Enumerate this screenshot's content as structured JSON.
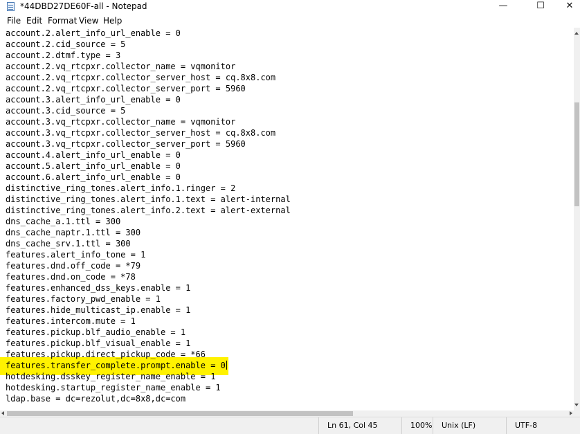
{
  "window": {
    "title": "*44DBD27DE60F-all - Notepad",
    "minimize_glyph": "—",
    "maximize_glyph": "☐",
    "close_glyph": "✕",
    "icon": "notepad-icon"
  },
  "menu": [
    "File",
    "Edit",
    "Format",
    "View",
    "Help"
  ],
  "editor": {
    "lines": [
      "account.2.alert_info_url_enable = 0",
      "account.2.cid_source = 5",
      "account.2.dtmf.type = 3",
      "account.2.vq_rtcpxr.collector_name = vqmonitor",
      "account.2.vq_rtcpxr.collector_server_host = cq.8x8.com",
      "account.2.vq_rtcpxr.collector_server_port = 5960",
      "account.3.alert_info_url_enable = 0",
      "account.3.cid_source = 5",
      "account.3.vq_rtcpxr.collector_name = vqmonitor",
      "account.3.vq_rtcpxr.collector_server_host = cq.8x8.com",
      "account.3.vq_rtcpxr.collector_server_port = 5960",
      "account.4.alert_info_url_enable = 0",
      "account.5.alert_info_url_enable = 0",
      "account.6.alert_info_url_enable = 0",
      "distinctive_ring_tones.alert_info.1.ringer = 2",
      "distinctive_ring_tones.alert_info.1.text = alert-internal",
      "distinctive_ring_tones.alert_info.2.text = alert-external",
      "dns_cache_a.1.ttl = 300",
      "dns_cache_naptr.1.ttl = 300",
      "dns_cache_srv.1.ttl = 300",
      "features.alert_info_tone = 1",
      "features.dnd.off_code = *79",
      "features.dnd.on_code = *78",
      "features.enhanced_dss_keys.enable = 1",
      "features.factory_pwd_enable = 1",
      "features.hide_multicast_ip.enable = 1",
      "features.intercom.mute = 1",
      "features.pickup.blf_audio_enable = 1",
      "features.pickup.blf_visual_enable = 1",
      "features.pickup.direct_pickup_code = *66",
      "features.transfer_complete.prompt.enable = 0",
      "hotdesking.dsskey_register_name_enable = 1",
      "hotdesking.startup_register_name_enable = 1",
      "ldap.base = dc=rezolut,dc=8x8,dc=com"
    ],
    "highlight_color": "#fff200"
  },
  "status": {
    "position": "Ln 61, Col 45",
    "zoom": "100%",
    "line_ending": "Unix (LF)",
    "encoding": "UTF-8"
  }
}
